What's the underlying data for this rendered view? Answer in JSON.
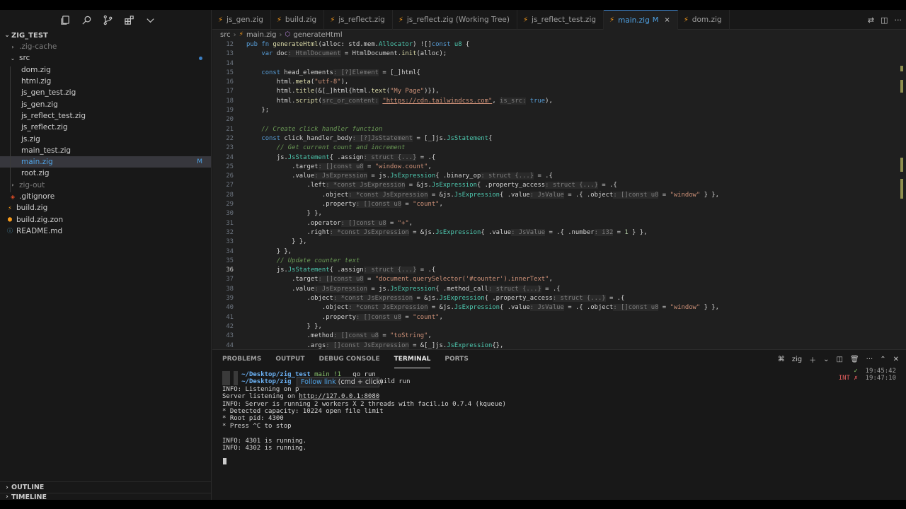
{
  "explorer": {
    "root": "ZIG_TEST",
    "items": [
      {
        "name": ".zig-cache",
        "type": "folder",
        "level": 1,
        "dim": true
      },
      {
        "name": "src",
        "type": "folder-open",
        "level": 1,
        "badge": "•"
      },
      {
        "name": "dom.zig",
        "type": "zig",
        "level": 2
      },
      {
        "name": "html.zig",
        "type": "zig",
        "level": 2
      },
      {
        "name": "js_gen_test.zig",
        "type": "zig",
        "level": 2
      },
      {
        "name": "js_gen.zig",
        "type": "zig",
        "level": 2
      },
      {
        "name": "js_reflect_test.zig",
        "type": "zig",
        "level": 2
      },
      {
        "name": "js_reflect.zig",
        "type": "zig",
        "level": 2
      },
      {
        "name": "js.zig",
        "type": "zig",
        "level": 2
      },
      {
        "name": "main_test.zig",
        "type": "zig",
        "level": 2
      },
      {
        "name": "main.zig",
        "type": "zig",
        "level": 2,
        "selected": true,
        "badge": "M"
      },
      {
        "name": "root.zig",
        "type": "zig",
        "level": 2
      },
      {
        "name": "zig-out",
        "type": "folder",
        "level": 1,
        "dim": true
      },
      {
        "name": ".gitignore",
        "type": "git",
        "level": 1
      },
      {
        "name": "build.zig",
        "type": "zig",
        "level": 0
      },
      {
        "name": "build.zig.zon",
        "type": "file",
        "level": 0
      },
      {
        "name": "README.md",
        "type": "md",
        "level": 0
      }
    ],
    "outline": "OUTLINE",
    "timeline": "TIMELINE"
  },
  "tabs": [
    {
      "label": "js_gen.zig"
    },
    {
      "label": "build.zig"
    },
    {
      "label": "js_reflect.zig"
    },
    {
      "label": "js_reflect.zig (Working Tree)"
    },
    {
      "label": "js_reflect_test.zig"
    },
    {
      "label": "main.zig",
      "active": true,
      "modified": "M",
      "close": "×"
    },
    {
      "label": "dom.zig"
    }
  ],
  "breadcrumb": {
    "folder": "src",
    "file": "main.zig",
    "symbol": "generateHtml"
  },
  "editor": {
    "current_line": 36,
    "lines": [
      {
        "n": 12,
        "html": "<span class='kw'>pub</span> <span class='kw'>fn</span> <span class='f'>generateHtml</span>(alloc: std.mem.<span class='t'>Allocator</span>) ![]<span class='kw'>const</span> <span class='t'>u8</span> {"
      },
      {
        "n": 13,
        "html": "    <span class='kw'>var</span> doc<span class='h'>: HtmlDocument</span> = HtmlDocument.<span class='f'>init</span>(alloc);"
      },
      {
        "n": 14,
        "html": ""
      },
      {
        "n": 15,
        "html": "    <span class='kw'>const</span> head_elements<span class='h'>: [?]Element</span> = <span class='p'>[_]</span>html{"
      },
      {
        "n": 16,
        "html": "        html.<span class='f'>meta</span>(<span class='s'>\"utf-8\"</span>),"
      },
      {
        "n": 17,
        "html": "        html.<span class='f'>title</span>(&amp;[_]html{html.<span class='f'>text</span>(<span class='s'>\"My Page\"</span>)}),"
      },
      {
        "n": 18,
        "html": "        html.<span class='f'>script</span>(<span class='h'>src_or_content:</span> <span class='u'>\"https://cdn.tailwindcss.com\"</span>, <span class='h'>is_src:</span> <span class='kw'>true</span>),"
      },
      {
        "n": 19,
        "html": "    };"
      },
      {
        "n": 20,
        "html": ""
      },
      {
        "n": 21,
        "html": "    <span class='c'>// Create click handler function</span>"
      },
      {
        "n": 22,
        "html": "    <span class='kw'>const</span> click_handler_body<span class='h'>: [?]JsStatement</span> = [_]js.<span class='t'>JsStatement</span>{"
      },
      {
        "n": 23,
        "html": "        <span class='c'>// Get current count and increment</span>"
      },
      {
        "n": 24,
        "html": "        js.<span class='t'>JsStatement</span>{ .assign<span class='h'>: struct {...}</span> = .{"
      },
      {
        "n": 25,
        "html": "            .target<span class='h'>: []const u8</span> = <span class='s'>\"window.count\"</span>,"
      },
      {
        "n": 26,
        "html": "            .value<span class='h'>: JsExpression</span> = js.<span class='t'>JsExpression</span>{ .binary_op<span class='h'>: struct {...}</span> = .{"
      },
      {
        "n": 27,
        "html": "                .left<span class='h'>: *const JsExpression</span> = &amp;js.<span class='t'>JsExpression</span>{ .property_access<span class='h'>: struct {...}</span> = .{"
      },
      {
        "n": 28,
        "html": "                    .object<span class='h'>: *const JsExpression</span> = &amp;js.<span class='t'>JsExpression</span>{ .value<span class='h'>: JsValue</span> = .{ .object<span class='h'>: []const u8</span> = <span class='s'>\"window\"</span> } },"
      },
      {
        "n": 29,
        "html": "                    .property<span class='h'>: []const u8</span> = <span class='s'>\"count\"</span>,"
      },
      {
        "n": 30,
        "html": "                } },"
      },
      {
        "n": 31,
        "html": "                .operator<span class='h'>: []const u8</span> = <span class='s'>\"+\"</span>,"
      },
      {
        "n": 32,
        "html": "                .right<span class='h'>: *const JsExpression</span> = &amp;js.<span class='t'>JsExpression</span>{ .value<span class='h'>: JsValue</span> = .{ .number<span class='h'>: i32</span> = <span class='n'>1</span> } },"
      },
      {
        "n": 33,
        "html": "            } },"
      },
      {
        "n": 34,
        "html": "        } },"
      },
      {
        "n": 35,
        "html": "        <span class='c'>// Update counter text</span>"
      },
      {
        "n": 36,
        "html": "        js.<span class='t'>JsStatement</span>{ .assign<span class='h'>: struct {...}</span> = .{"
      },
      {
        "n": 37,
        "html": "            .target<span class='h'>: []const u8</span> = <span class='s'>\"document.querySelector('#counter').innerText\"</span>,"
      },
      {
        "n": 38,
        "html": "            .value<span class='h'>: JsExpression</span> = js.<span class='t'>JsExpression</span>{ .method_call<span class='h'>: struct {...}</span> = .{"
      },
      {
        "n": 39,
        "html": "                .object<span class='h'>: *const JsExpression</span> = &amp;js.<span class='t'>JsExpression</span>{ .property_access<span class='h'>: struct {...}</span> = .{"
      },
      {
        "n": 40,
        "html": "                    .object<span class='h'>: *const JsExpression</span> = &amp;js.<span class='t'>JsExpression</span>{ .value<span class='h'>: JsValue</span> = .{ .object<span class='h'>: []const u8</span> = <span class='s'>\"window\"</span> } },"
      },
      {
        "n": 41,
        "html": "                    .property<span class='h'>: []const u8</span> = <span class='s'>\"count\"</span>,"
      },
      {
        "n": 42,
        "html": "                } },"
      },
      {
        "n": 43,
        "html": "                .method<span class='h'>: []const u8</span> = <span class='s'>\"toString\"</span>,"
      },
      {
        "n": 44,
        "html": "                .args<span class='h'>: []const JsExpression</span> = &amp;[_]js.<span class='t'>JsExpression</span>{},"
      }
    ]
  },
  "panel": {
    "tabs": [
      "PROBLEMS",
      "OUTPUT",
      "DEBUG CONSOLE",
      "TERMINAL",
      "PORTS"
    ],
    "active_tab": "TERMINAL",
    "shell_label": "zig",
    "terminal": {
      "prompt1_dir": "~/Desktop/zig_test",
      "prompt1_branch": "main !1",
      "prompt1_cmd": "go run",
      "prompt2_dir": "~/Desktop/zig",
      "prompt2_cmd": "ig build run",
      "output": [
        "INFO: Listening on p",
        "Server listening on ",
        "INFO: Server is running 2 workers X 2 threads with facil.io 0.7.4 (kqueue)",
        "* Detected capacity: 10224 open file limit",
        "* Root pid: 4300",
        "* Press ^C to stop",
        "",
        "INFO: 4301 is running.",
        "INFO: 4302 is running."
      ],
      "server_url": "http://127.0.0.1:8080",
      "status1_mark": "✓",
      "status1_time": "19:45:42",
      "status2_label": "INT",
      "status2_mark": "✗",
      "status2_time": "19:47:10"
    },
    "tooltip_link": "Follow link",
    "tooltip_hint": "(cmd + click)"
  },
  "colors": {
    "accent": "#3b7fc4",
    "zig": "#f69a1b",
    "modified": "#e2c08d"
  }
}
